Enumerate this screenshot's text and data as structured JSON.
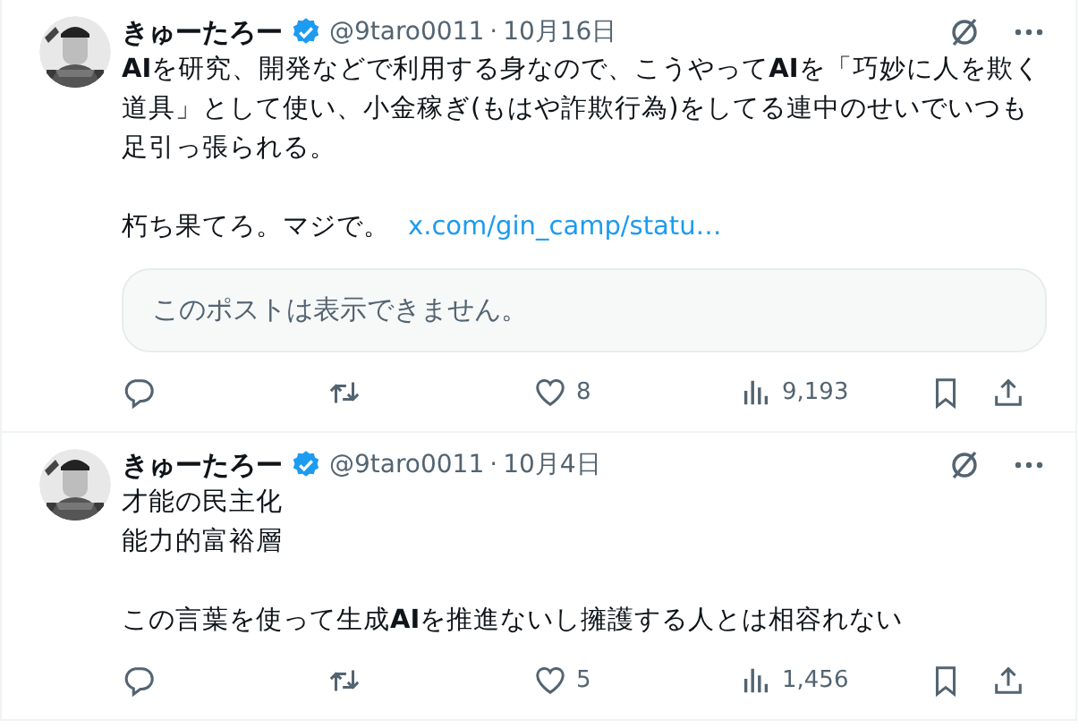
{
  "posts": [
    {
      "name": "きゅーたろー",
      "verified": true,
      "handle": "@9taro0011",
      "separator": "·",
      "date": "10月16日",
      "paragraphs": [
        {
          "lines": [
            "**AI**を研究、開発などで利用する身なので、こうやって**AI**を「巧妙に人を欺く",
            "道具」として使い、小金稼ぎ(もはや詐欺行為)をしてる連中のせいでいつも",
            "足引っ張られる。"
          ]
        },
        {
          "lines": [
            "朽ち果てろ。マジで。"
          ],
          "link": "x.com/gin_camp/statu…"
        }
      ],
      "quote": {
        "text": "このポストは表示できません。"
      },
      "metrics": [
        {
          "kind": "reply"
        },
        {
          "kind": "repost"
        },
        {
          "kind": "like",
          "count": "8"
        },
        {
          "kind": "views",
          "count": "9,193"
        },
        {
          "kind": "bookmark"
        },
        {
          "kind": "share"
        }
      ]
    },
    {
      "name": "きゅーたろー",
      "verified": true,
      "handle": "@9taro0011",
      "separator": "·",
      "date": "10月4日",
      "paragraphs": [
        {
          "lines": [
            "才能の民主化",
            "能力的富裕層"
          ]
        },
        {
          "lines": [
            "この言葉を使って生成**AI**を推進ないし擁護する人とは相容れない"
          ]
        }
      ],
      "metrics": [
        {
          "kind": "reply"
        },
        {
          "kind": "repost"
        },
        {
          "kind": "like",
          "count": "5"
        },
        {
          "kind": "views",
          "count": "1,456"
        },
        {
          "kind": "bookmark"
        },
        {
          "kind": "share"
        }
      ]
    }
  ]
}
